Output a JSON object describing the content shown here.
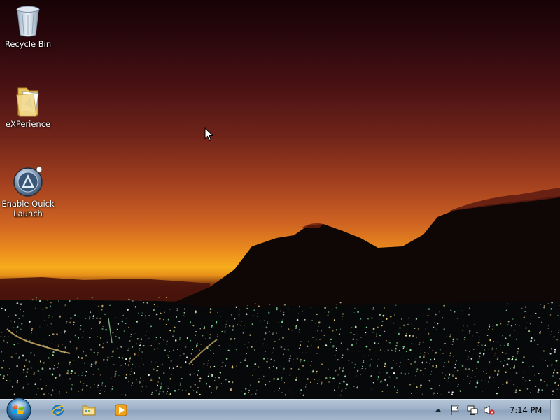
{
  "desktop": {
    "icons": [
      {
        "label": "Recycle Bin",
        "icon": "recycle-bin-icon"
      },
      {
        "label": "eXPerience",
        "icon": "folder-icon"
      },
      {
        "label": "Enable Quick\nLaunch",
        "icon": "quick-launch-icon"
      }
    ]
  },
  "taskbar": {
    "start_icon": "windows-orb-icon",
    "pinned": [
      {
        "icon": "internet-explorer-icon"
      },
      {
        "icon": "windows-explorer-icon"
      },
      {
        "icon": "media-player-icon"
      }
    ],
    "tray": {
      "icons": [
        "show-hidden-icons-arrow",
        "action-center-flag-icon",
        "network-icon",
        "volume-muted-icon"
      ],
      "clock": "7:14 PM"
    }
  },
  "colors": {
    "taskbar": "#9db1c8",
    "sky_top": "#170306",
    "horizon": "#f7ad1c",
    "city_lights": "#9cf0a8"
  }
}
